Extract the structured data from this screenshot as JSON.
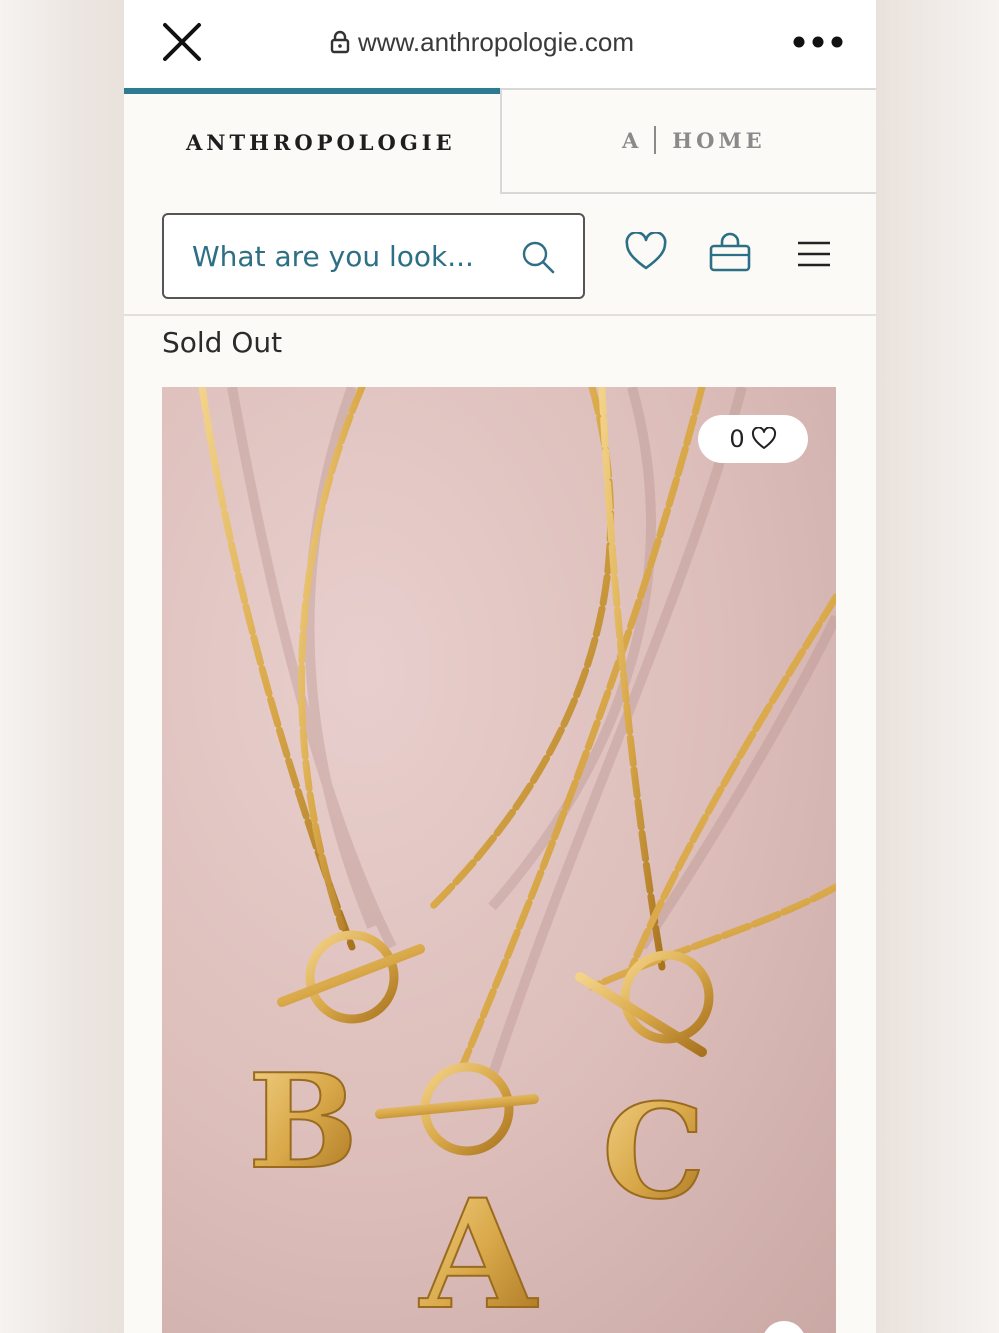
{
  "browser": {
    "url": "www.anthropologie.com",
    "icons": [
      "close-icon",
      "lock-icon",
      "more-icon"
    ]
  },
  "tabs": [
    {
      "label": "ANTHROPOLOGIE",
      "active": true
    },
    {
      "label_left": "A",
      "label_right": "HOME",
      "active": false
    }
  ],
  "search": {
    "placeholder": "What are you look...",
    "icon": "search-icon"
  },
  "header_icons": [
    "heart-icon",
    "bag-icon",
    "menu-icon"
  ],
  "product": {
    "status": "Sold Out",
    "favorites_count": "0",
    "pendant_letters": [
      "B",
      "A",
      "C"
    ]
  },
  "colors": {
    "accent": "#2d7b92",
    "search_text": "#2d6f85",
    "image_background": "#dcbdb9",
    "gold": "#d9a94a"
  }
}
